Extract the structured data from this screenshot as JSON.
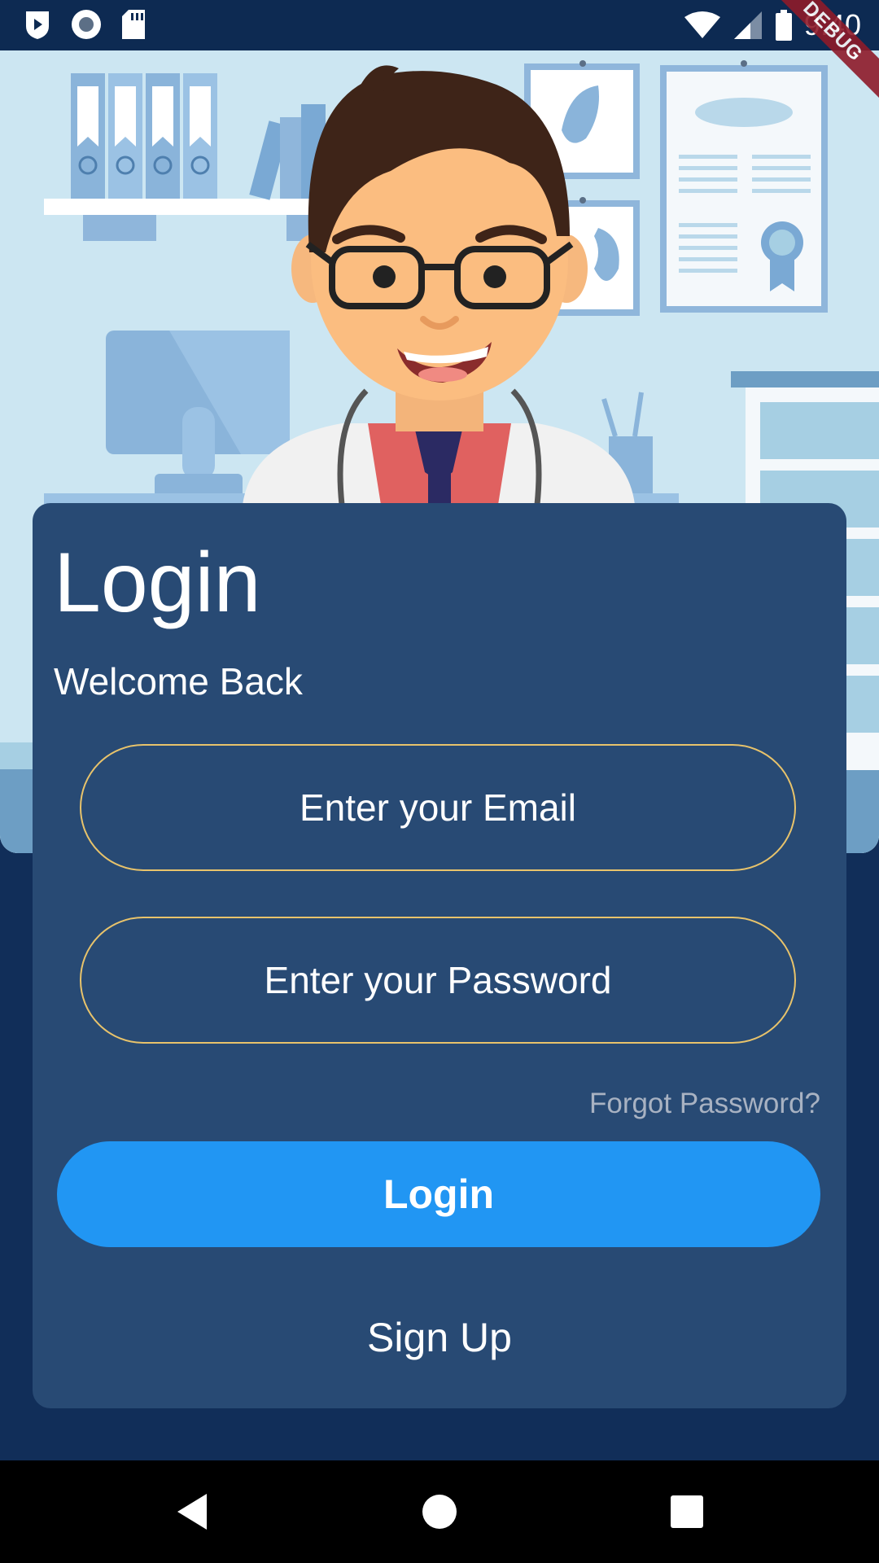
{
  "status_bar": {
    "time": "9:40",
    "icons": [
      "play-icon",
      "record-icon",
      "sd-card-icon",
      "wifi-icon",
      "signal-icon",
      "battery-icon"
    ]
  },
  "debug_banner": "DEBUG",
  "hero": {
    "illustration": "doctor-office-illustration"
  },
  "login_card": {
    "title": "Login",
    "subtitle": "Welcome Back",
    "email_placeholder": "Enter your Email",
    "password_placeholder": "Enter your Password",
    "forgot_password": "Forgot Password?",
    "login_button": "Login",
    "signup_link": "Sign Up"
  },
  "colors": {
    "background": "#112e59",
    "card": "#284a74",
    "accent_button": "#2196f3",
    "field_border": "#e8c36b"
  },
  "nav_bar": {
    "icons": [
      "back-icon",
      "home-icon",
      "recents-icon"
    ]
  }
}
